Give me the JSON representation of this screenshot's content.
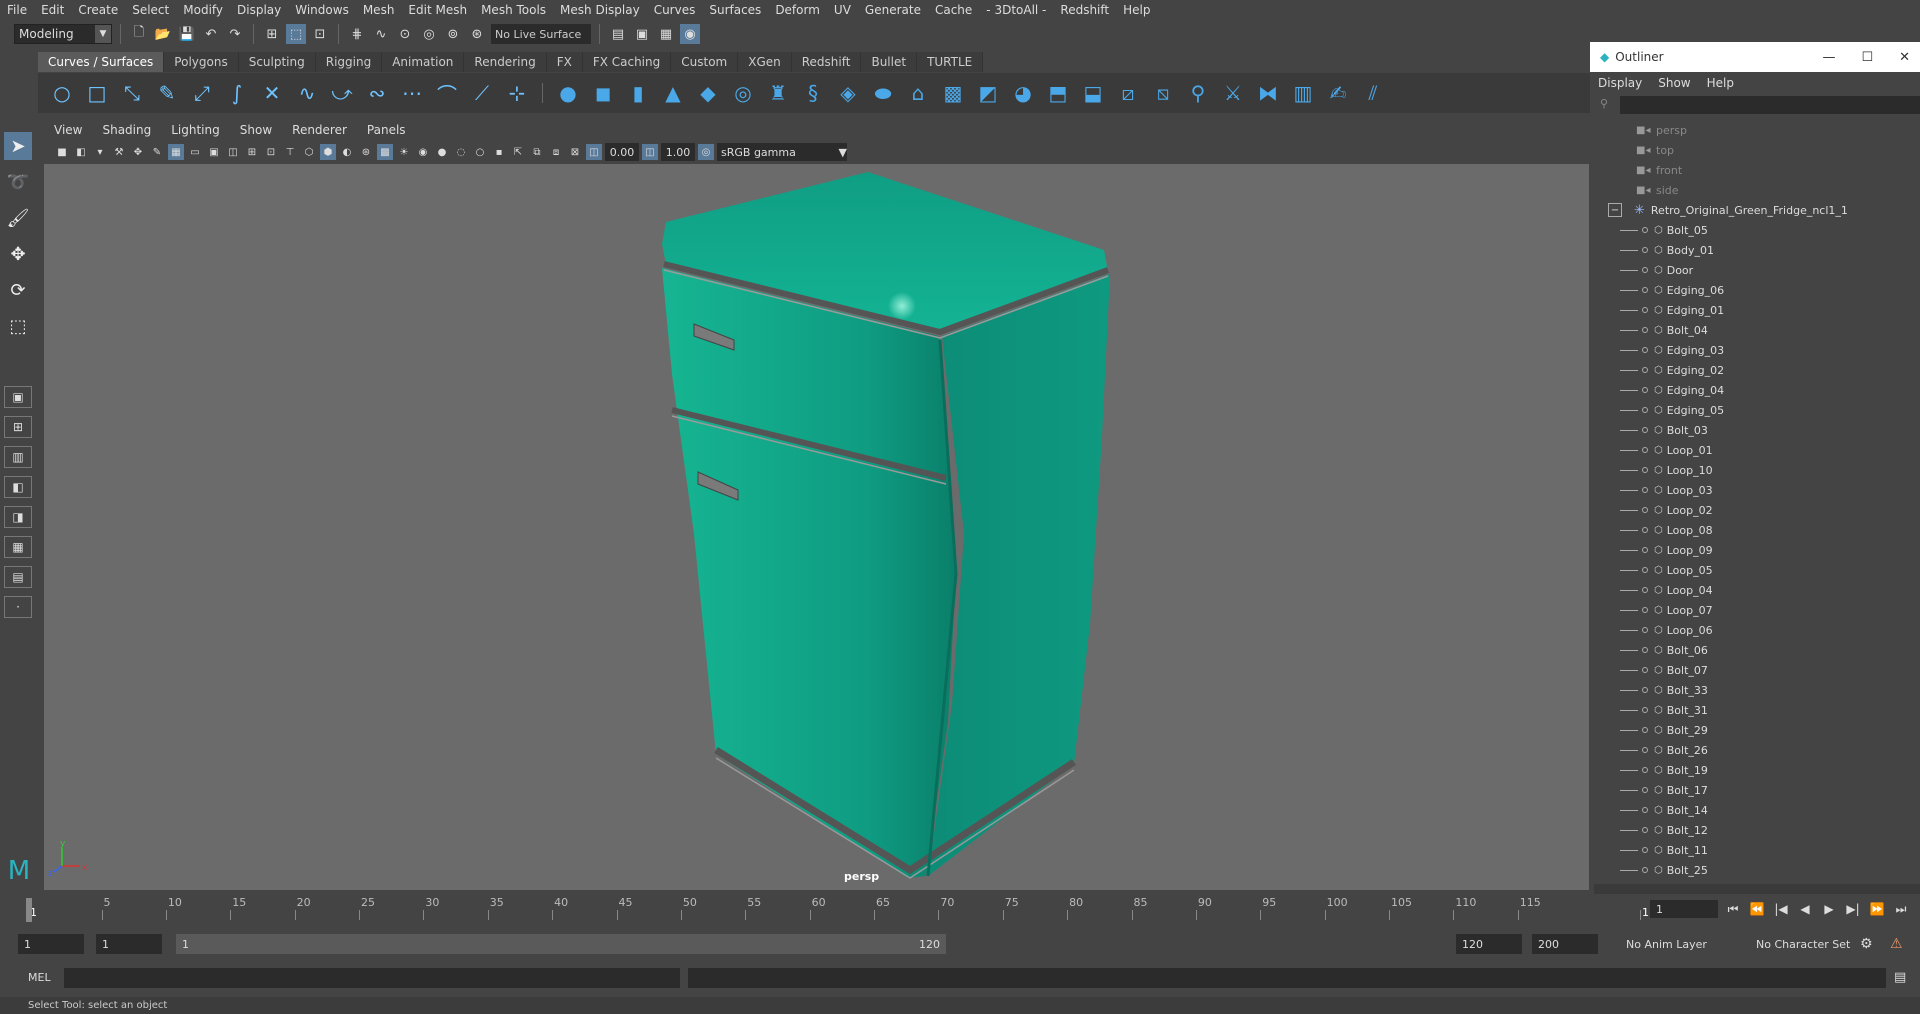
{
  "menubar": [
    "File",
    "Edit",
    "Create",
    "Select",
    "Modify",
    "Display",
    "Windows",
    "Mesh",
    "Edit Mesh",
    "Mesh Tools",
    "Mesh Display",
    "Curves",
    "Surfaces",
    "Deform",
    "UV",
    "Generate",
    "Cache",
    "- 3DtoAll -",
    "Redshift",
    "Help"
  ],
  "status": {
    "mode": "Modeling",
    "live_surface": "No Live Surface"
  },
  "shelf_tabs": [
    "Curves / Surfaces",
    "Polygons",
    "Sculpting",
    "Rigging",
    "Animation",
    "Rendering",
    "FX",
    "FX Caching",
    "Custom",
    "XGen",
    "Redshift",
    "Bullet",
    "TURTLE"
  ],
  "shelf_active": "Curves / Surfaces",
  "viewport": {
    "menus": [
      "View",
      "Shading",
      "Lighting",
      "Show",
      "Renderer",
      "Panels"
    ],
    "exposure": "0.00",
    "gamma": "1.00",
    "color_space": "sRGB gamma",
    "camera": "persp",
    "axis": {
      "x": "x",
      "y": "y",
      "z": "z"
    },
    "model_color": "#0f9c82"
  },
  "outliner": {
    "title": "Outliner",
    "menus": [
      "Display",
      "Show",
      "Help"
    ],
    "cameras": [
      "persp",
      "top",
      "front",
      "side"
    ],
    "group": "Retro_Original_Green_Fridge_ncl1_1",
    "items": [
      "Bolt_05",
      "Body_01",
      "Door",
      "Edging_06",
      "Edging_01",
      "Bolt_04",
      "Edging_03",
      "Edging_02",
      "Edging_04",
      "Edging_05",
      "Bolt_03",
      "Loop_01",
      "Loop_10",
      "Loop_03",
      "Loop_02",
      "Loop_08",
      "Loop_09",
      "Loop_05",
      "Loop_04",
      "Loop_07",
      "Loop_06",
      "Bolt_06",
      "Bolt_07",
      "Bolt_33",
      "Bolt_31",
      "Bolt_29",
      "Bolt_26",
      "Bolt_19",
      "Bolt_17",
      "Bolt_14",
      "Bolt_12",
      "Bolt_11",
      "Bolt_25"
    ]
  },
  "timeline": {
    "ticks": [
      "1",
      "5",
      "10",
      "15",
      "20",
      "25",
      "30",
      "35",
      "40",
      "45",
      "50",
      "55",
      "60",
      "65",
      "70",
      "75",
      "80",
      "85",
      "90",
      "95",
      "100",
      "105",
      "110",
      "115",
      "1"
    ],
    "current_frame": "1",
    "range_start": "1",
    "range_start2": "1",
    "range_inner_start": "1",
    "range_inner_end": "120",
    "range_end": "120",
    "range_end2": "200",
    "anim_layer": "No Anim Layer",
    "char_set": "No Character Set"
  },
  "cmd": {
    "label": "MEL",
    "help": "Select Tool: select an object"
  }
}
